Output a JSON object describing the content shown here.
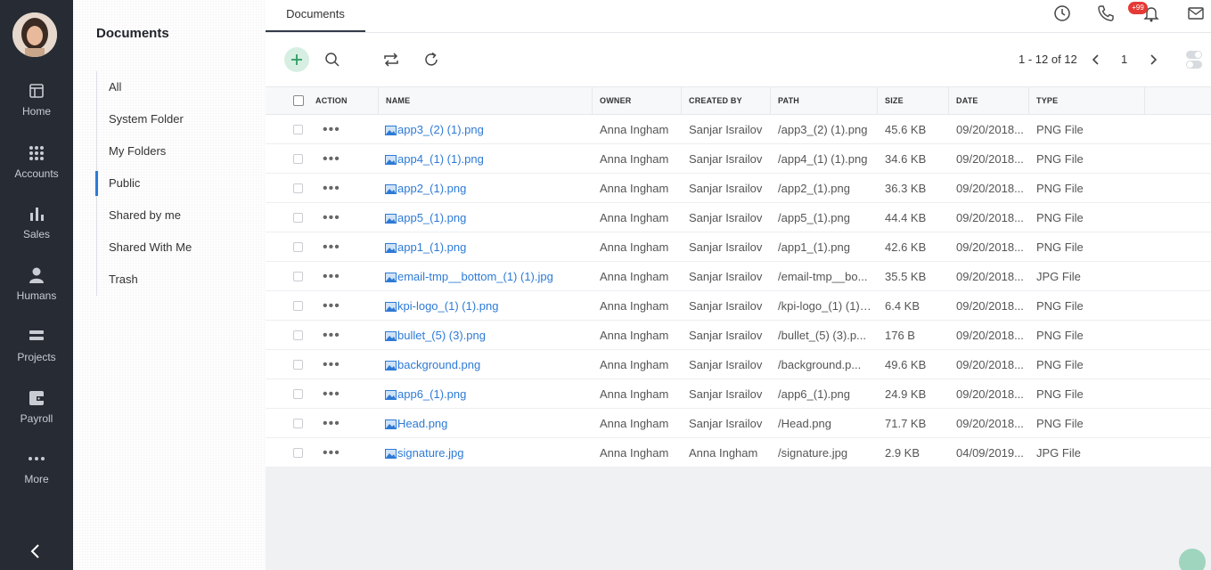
{
  "leftnav": {
    "items": [
      {
        "label": "Home",
        "icon": "home-icon"
      },
      {
        "label": "Accounts",
        "icon": "grid-icon"
      },
      {
        "label": "Sales",
        "icon": "bar-chart-icon"
      },
      {
        "label": "Humans",
        "icon": "person-icon"
      },
      {
        "label": "Projects",
        "icon": "projects-icon"
      },
      {
        "label": "Payroll",
        "icon": "wallet-icon"
      },
      {
        "label": "More",
        "icon": "more-dots-icon"
      }
    ]
  },
  "sidebar": {
    "title": "Documents",
    "items": [
      {
        "label": "All"
      },
      {
        "label": "System Folder"
      },
      {
        "label": "My Folders"
      },
      {
        "label": "Public"
      },
      {
        "label": "Shared by me"
      },
      {
        "label": "Shared With Me"
      },
      {
        "label": "Trash"
      }
    ],
    "active": "Public"
  },
  "header": {
    "tab": "Documents",
    "notification_count": "+99"
  },
  "toolbar": {
    "pager_text": "1 - 12 of 12",
    "page": "1"
  },
  "table": {
    "columns": [
      "ACTION",
      "NAME",
      "OWNER",
      "CREATED BY",
      "PATH",
      "SIZE",
      "DATE",
      "TYPE"
    ],
    "rows": [
      {
        "name": "app3_(2) (1).png",
        "owner": "Anna Ingham",
        "created_by": "Sanjar Israilov",
        "path": "/app3_(2) (1).png",
        "size": "45.6 KB",
        "date": "09/20/2018...",
        "type": "PNG File"
      },
      {
        "name": "app4_(1) (1).png",
        "owner": "Anna Ingham",
        "created_by": "Sanjar Israilov",
        "path": "/app4_(1) (1).png",
        "size": "34.6 KB",
        "date": "09/20/2018...",
        "type": "PNG File"
      },
      {
        "name": "app2_(1).png",
        "owner": "Anna Ingham",
        "created_by": "Sanjar Israilov",
        "path": "/app2_(1).png",
        "size": "36.3 KB",
        "date": "09/20/2018...",
        "type": "PNG File"
      },
      {
        "name": "app5_(1).png",
        "owner": "Anna Ingham",
        "created_by": "Sanjar Israilov",
        "path": "/app5_(1).png",
        "size": "44.4 KB",
        "date": "09/20/2018...",
        "type": "PNG File"
      },
      {
        "name": "app1_(1).png",
        "owner": "Anna Ingham",
        "created_by": "Sanjar Israilov",
        "path": "/app1_(1).png",
        "size": "42.6 KB",
        "date": "09/20/2018...",
        "type": "PNG File"
      },
      {
        "name": "email-tmp__bottom_(1) (1).jpg",
        "owner": "Anna Ingham",
        "created_by": "Sanjar Israilov",
        "path": "/email-tmp__bo...",
        "size": "35.5 KB",
        "date": "09/20/2018...",
        "type": "JPG File"
      },
      {
        "name": "kpi-logo_(1) (1).png",
        "owner": "Anna Ingham",
        "created_by": "Sanjar Israilov",
        "path": "/kpi-logo_(1) (1)....",
        "size": "6.4 KB",
        "date": "09/20/2018...",
        "type": "PNG File"
      },
      {
        "name": "bullet_(5) (3).png",
        "owner": "Anna Ingham",
        "created_by": "Sanjar Israilov",
        "path": "/bullet_(5) (3).p...",
        "size": "176 B",
        "date": "09/20/2018...",
        "type": "PNG File"
      },
      {
        "name": "background.png",
        "owner": "Anna Ingham",
        "created_by": "Sanjar Israilov",
        "path": "/background.p...",
        "size": "49.6 KB",
        "date": "09/20/2018...",
        "type": "PNG File"
      },
      {
        "name": "app6_(1).png",
        "owner": "Anna Ingham",
        "created_by": "Sanjar Israilov",
        "path": "/app6_(1).png",
        "size": "24.9 KB",
        "date": "09/20/2018...",
        "type": "PNG File"
      },
      {
        "name": "Head.png",
        "owner": "Anna Ingham",
        "created_by": "Sanjar Israilov",
        "path": "/Head.png",
        "size": "71.7 KB",
        "date": "09/20/2018...",
        "type": "PNG File"
      },
      {
        "name": "signature.jpg",
        "owner": "Anna Ingham",
        "created_by": "Anna Ingham",
        "path": "/signature.jpg",
        "size": "2.9 KB",
        "date": "04/09/2019...",
        "type": "JPG File"
      }
    ]
  },
  "colors": {
    "nav_bg": "#262b34",
    "accent": "#2d7ad6",
    "add_button_bg": "#d7efe2",
    "badge": "#e53935"
  }
}
